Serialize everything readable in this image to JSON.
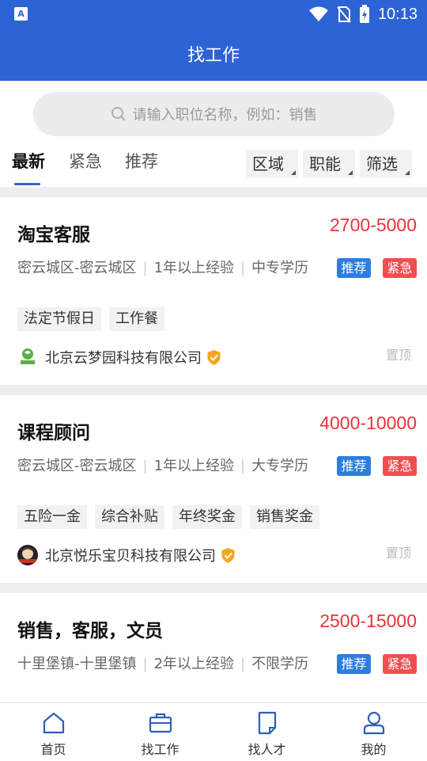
{
  "status": {
    "time": "10:13"
  },
  "header": {
    "title": "找工作"
  },
  "search": {
    "placeholder": "请输入职位名称，例如：销售"
  },
  "tabs": [
    {
      "label": "最新",
      "active": true
    },
    {
      "label": "紧急",
      "active": false
    },
    {
      "label": "推荐",
      "active": false
    }
  ],
  "filters": [
    "区域",
    "职能",
    "筛选"
  ],
  "jobs": [
    {
      "title": "淘宝客服",
      "salary": "2700-5000",
      "location": "密云城区-密云城区",
      "experience": "1年以上经验",
      "education": "中专学历",
      "badge_recommend": "推荐",
      "badge_urgent": "紧急",
      "tags": [
        "法定节假日",
        "工作餐"
      ],
      "company": "北京云梦园科技有限公司",
      "pin": "置顶"
    },
    {
      "title": "课程顾问",
      "salary": "4000-10000",
      "location": "密云城区-密云城区",
      "experience": "1年以上经验",
      "education": "大专学历",
      "badge_recommend": "推荐",
      "badge_urgent": "紧急",
      "tags": [
        "五险一金",
        "综合补贴",
        "年终奖金",
        "销售奖金"
      ],
      "company": "北京悦乐宝贝科技有限公司",
      "pin": "置顶"
    },
    {
      "title": "销售，客服，文员",
      "salary": "2500-15000",
      "location": "十里堡镇-十里堡镇",
      "experience": "2年以上经验",
      "education": "不限学历",
      "badge_recommend": "推荐",
      "badge_urgent": "紧急"
    }
  ],
  "bottom_nav": [
    {
      "label": "首页",
      "icon": "home-icon"
    },
    {
      "label": "找工作",
      "icon": "briefcase-icon"
    },
    {
      "label": "找人才",
      "icon": "document-icon"
    },
    {
      "label": "我的",
      "icon": "user-icon"
    }
  ],
  "colors": {
    "primary": "#2e63d6",
    "salary": "#e8333a",
    "recommend": "#2e7ddf",
    "urgent": "#f04e52",
    "verified": "#f5a623"
  }
}
